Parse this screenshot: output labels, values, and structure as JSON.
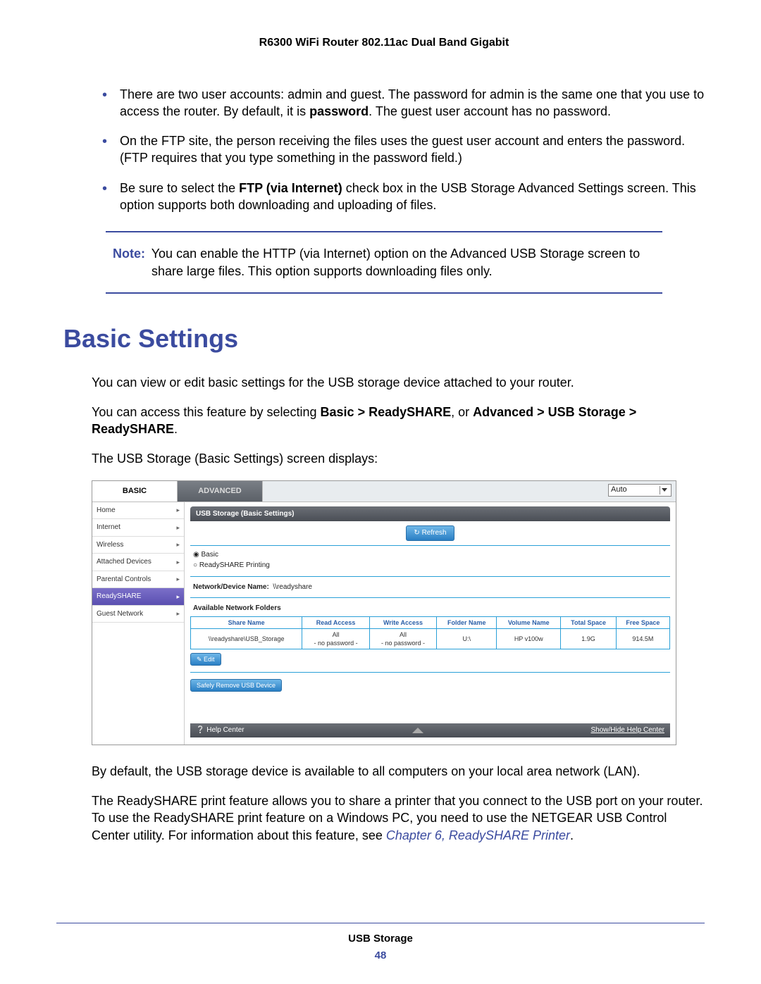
{
  "header": "R6300 WiFi Router 802.11ac Dual Band Gigabit",
  "bullets": [
    {
      "pre": "There are two user accounts: admin and guest. The password for admin is the same one that you use to access the router. By default, it is ",
      "bold": "password",
      "post": ". The guest user account has no password."
    },
    {
      "pre": "On the FTP site, the person receiving the files uses the guest user account and enters the password. (FTP requires that you type something in the password field.)",
      "bold": "",
      "post": ""
    },
    {
      "pre": "Be sure to select the ",
      "bold": "FTP (via Internet)",
      "post": " check box in the USB Storage Advanced Settings screen. This option supports both downloading and uploading of files."
    }
  ],
  "note": {
    "label": "Note:",
    "text": "You can enable the HTTP (via Internet) option on the Advanced USB Storage screen to share large files. This option supports downloading files only."
  },
  "section_title": "Basic Settings",
  "p1": "You can view or edit basic settings for the USB storage device attached to your router.",
  "p2_pre": "You can access this feature by selecting ",
  "p2_b1": "Basic > ReadySHARE",
  "p2_mid": ", or ",
  "p2_b2": "Advanced > USB Storage > ReadySHARE",
  "p2_post": ".",
  "p3": "The USB Storage (Basic Settings) screen displays:",
  "ui": {
    "tab_basic": "BASIC",
    "tab_advanced": "ADVANCED",
    "select_value": "Auto",
    "sidebar": [
      "Home",
      "Internet",
      "Wireless",
      "Attached Devices",
      "Parental Controls",
      "ReadySHARE",
      "Guest Network"
    ],
    "sidebar_active_index": 5,
    "panel_title": "USB Storage (Basic Settings)",
    "refresh": "Refresh",
    "radio_basic": "Basic",
    "radio_print": "ReadySHARE Printing",
    "device_label": "Network/Device Name:",
    "device_value": "\\\\readyshare",
    "folders_label": "Available Network Folders",
    "cols": [
      "Share Name",
      "Read Access",
      "Write Access",
      "Folder Name",
      "Volume Name",
      "Total Space",
      "Free Space"
    ],
    "row": [
      "\\\\readyshare\\USB_Storage",
      "All\n- no password -",
      "All\n- no password -",
      "U:\\",
      "HP v100w",
      "1.9G",
      "914.5M"
    ],
    "edit": "Edit",
    "safely_remove": "Safely Remove USB Device",
    "help_center": "Help Center",
    "show_hide": "Show/Hide Help Center"
  },
  "p4": "By default, the USB storage device is available to all computers on your local area network (LAN).",
  "p5_pre": "The ReadySHARE print feature allows you to share a printer that you connect to the USB port on your router. To use the ReadySHARE print feature on a Windows PC, you need to use the NETGEAR USB Control Center utility. For information about this feature, see ",
  "p5_link": "Chapter 6, ReadySHARE Printer",
  "p5_post": ".",
  "footer_section": "USB Storage",
  "footer_page": "48"
}
